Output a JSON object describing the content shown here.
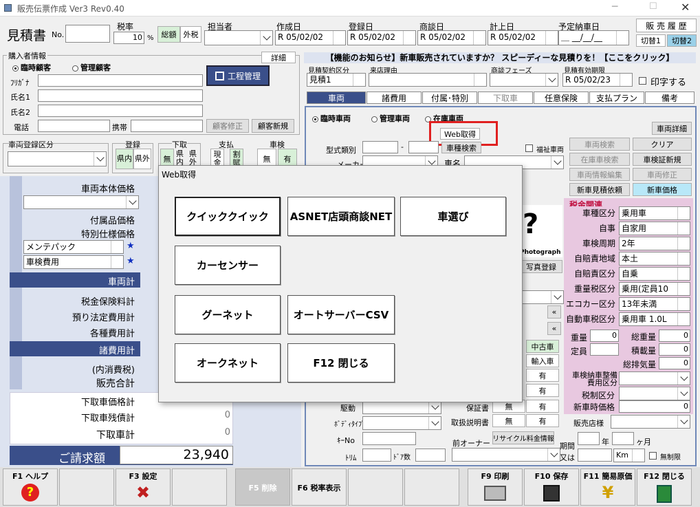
{
  "window": {
    "title": "販売伝票作成 Ver3 Rev0.40"
  },
  "header": {
    "doc_type": "見積書",
    "no_label": "No.",
    "tax_rate_label": "税率",
    "tax_rate": "10",
    "percent": "%",
    "tax_total": "総額",
    "tax_excl": "外税",
    "staff_label": "担当者",
    "created_label": "作成日",
    "created": "R 05/02/02",
    "registered_label": "登録日",
    "registered": "R 05/02/02",
    "deal_label": "商談日",
    "deal": "R 05/02/02",
    "booked_label": "計上日",
    "booked": "R 05/02/02",
    "delivery_label": "予定納車日",
    "delivery": "＿ __/__/__",
    "history_button": "販 売 履 歴",
    "switch1": "切替1",
    "switch2": "切替2"
  },
  "buyer": {
    "section": "購入者情報",
    "detail_button": "詳細",
    "temp_customer": "臨時顧客",
    "mgmt_customer": "管理顧客",
    "kana_label": "ﾌﾘｶﾞﾅ",
    "name1_label": "氏名1",
    "name2_label": "氏名2",
    "phone_label": "電話",
    "mobile_label": "携帯",
    "edit_button": "顧客修正",
    "new_button": "顧客新規",
    "process_button": "工程管理"
  },
  "regline": {
    "vehicle_reg_label": "車両登録区分",
    "reg_label": "登録",
    "reg_in": "県内",
    "reg_out": "県外",
    "trade_label": "下取",
    "trade_none": "無",
    "trade_in": "県内",
    "trade_out": "県外",
    "pay_label": "支払",
    "pay_cash": "現金",
    "pay_install": "割賦",
    "inspect_label": "車検",
    "inspect_none": "無",
    "inspect_yes": "有"
  },
  "notice": "【機能のお知らせ】新車販売されていますか？ スピーディーな見積りを！【ここをクリック】",
  "estimate": {
    "contract_label": "見積契約区分",
    "contract": "見積1",
    "visit_label": "来店理由",
    "phase_label": "商談フェーズ",
    "validity_label": "見積有効期限",
    "validity": "R 05/02/23",
    "print_label": "印字する"
  },
  "tabs": [
    "車両",
    "諸費用",
    "付属･特別",
    "下取車",
    "任意保険",
    "支払プラン",
    "備考"
  ],
  "vehicle": {
    "temp": "臨時車両",
    "mgmt": "管理車両",
    "stock": "在庫車両",
    "web_button": "Web取得",
    "model_label": "型式類別",
    "model_search": "車種検索",
    "welfare": "福祉車両",
    "maker_label": "メーカー",
    "name_label": "車名",
    "search_button": "車両検索",
    "clear_button": "クリア",
    "stock_search": "在庫車検索",
    "inspect_new": "車検証新規",
    "info_edit": "車両情報編集",
    "vehicle_edit": "車両修正",
    "new_estimate": "新車見積依頼",
    "new_price": "新車価格",
    "detail_button": "車両詳細",
    "photo_text": "Photograph",
    "photo_reg": "写真登録",
    "used": "中古車",
    "import": "輸入車",
    "yes1": "有",
    "yes2": "有",
    "yes3": "有",
    "none1": "無",
    "none2": "無",
    "yes4": "有",
    "yes5": "有",
    "drive_label": "駆動",
    "body_label": "ﾎﾞﾃﾞｨﾀｲﾌﾟ",
    "key_label": "ｷｰNo",
    "trim_label": "ﾄﾘﾑ",
    "doors_label": "ﾄﾞｱ数",
    "warranty_label": "保証書",
    "manual_label": "取扱説明書",
    "prev_owner_label": "前オーナー",
    "recycle_button": "リサイクル料金情報",
    "period_label": "期間",
    "year_label": "年",
    "month_label": "ヶ月",
    "or_label": "又は",
    "km": "Km",
    "unlimited": "無制限"
  },
  "tax": {
    "title": "税金関連",
    "rows": [
      {
        "label": "車種区分",
        "value": "乗用車"
      },
      {
        "label": "自事",
        "value": "自家用"
      },
      {
        "label": "車検周期",
        "value": "2年"
      },
      {
        "label": "自賠責地域",
        "value": "本土"
      },
      {
        "label": "自賠責区分",
        "value": "自乗"
      },
      {
        "label": "重量税区分",
        "value": "乗用(定員10"
      },
      {
        "label": "エコカー区分",
        "value": "13年未満"
      },
      {
        "label": "自動車税区分",
        "value": "乗用車 1.0L"
      }
    ],
    "weight_label": "重量",
    "weight": "0",
    "gross_label": "総重量",
    "gross": "0",
    "capacity_label": "定員",
    "load_label": "積載量",
    "load": "0",
    "displacement_label": "総排気量",
    "displacement": "0",
    "cost_div_label": "車検納車整備費用区分",
    "tax_div_label": "税制区分",
    "new_price_label": "新車時価格",
    "new_price": "0",
    "dealer_label": "販売店様"
  },
  "prices": {
    "body_label": "車両本体価格",
    "accessory_label": "付属品価格",
    "special_label": "特別仕様価格",
    "maint": "メンテパック",
    "inspect_cost": "車検費用",
    "star": "★",
    "vehicle_total": "車両計",
    "tax_ins_label": "税金保険料計",
    "legal_label": "預り法定費用計",
    "fees_label": "各種費用計",
    "misc_total": "諸費用計",
    "consumption_label": "(内消費税)",
    "sales_total": "販売合計",
    "trade_price_label": "下取車価格計",
    "trade_balance_label": "下取車残債計",
    "trade_balance": "0",
    "trade_total": "下取車計",
    "trade_total_value": "0",
    "billing_label": "ご請求額",
    "billing": "23,940"
  },
  "dialog": {
    "title": "Web取得",
    "buttons": {
      "quick": "クイッククイック",
      "asnet": "ASNET店頭商談NET",
      "kuruma": "車選び",
      "carsensor": "カーセンサー",
      "goonet": "グーネット",
      "autoserver": "オートサーバーCSV",
      "aucnet": "オークネット",
      "close": "F12 閉じる"
    }
  },
  "fkeys": {
    "f1": "F1 ヘルプ",
    "f3": "F3 設定",
    "f5": "F5 削除",
    "f6": "F6 税率表示",
    "f9": "F9 印刷",
    "f10": "F10 保存",
    "f11": "F11 簡易原価",
    "f12": "F12 閉じる"
  },
  "colors": {
    "accent_blue": "#3a4f8a",
    "highlight": "#d8f0d8",
    "tax_pink": "#e8c8e0",
    "active_cyan": "#b8e8f8",
    "callout": "#e02020"
  }
}
